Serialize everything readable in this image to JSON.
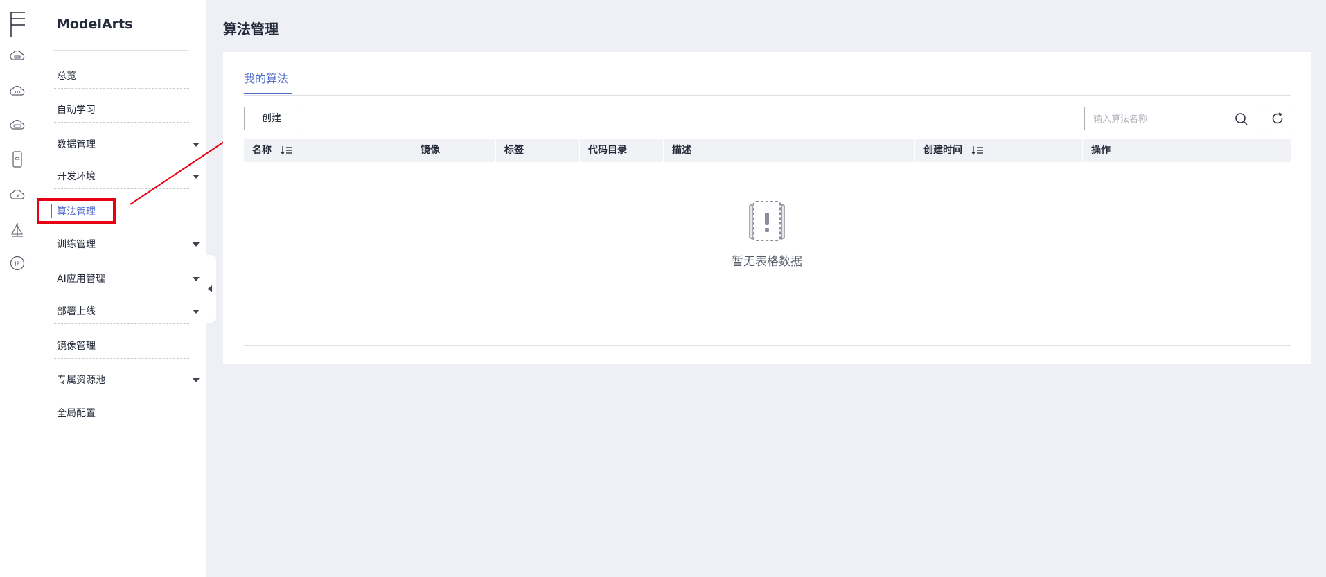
{
  "app": {
    "name": "ModelArts"
  },
  "sidebar": {
    "items": [
      {
        "label": "总览",
        "has_children": false
      },
      {
        "label": "自动学习",
        "has_children": false
      },
      {
        "label": "数据管理",
        "has_children": true
      },
      {
        "label": "开发环境",
        "has_children": true
      },
      {
        "label": "算法管理",
        "has_children": false,
        "active": true
      },
      {
        "label": "训练管理",
        "has_children": true
      },
      {
        "label": "AI应用管理",
        "has_children": true
      },
      {
        "label": "部署上线",
        "has_children": true
      },
      {
        "label": "镜像管理",
        "has_children": false
      },
      {
        "label": "专属资源池",
        "has_children": true
      },
      {
        "label": "全局配置",
        "has_children": false
      }
    ]
  },
  "page": {
    "title": "算法管理",
    "tabs": [
      {
        "label": "我的算法",
        "active": true
      }
    ],
    "toolbar": {
      "create_label": "创建",
      "search_placeholder": "输入算法名称"
    },
    "table": {
      "columns": [
        "名称",
        "镜像",
        "标签",
        "代码目录",
        "描述",
        "创建时间",
        "操作"
      ],
      "rows": [],
      "empty_text": "暂无表格数据"
    }
  },
  "theme": {
    "accent": "#526ecc",
    "annotation": "#e60012",
    "background": "#eff0f5"
  },
  "icons": [
    "menu-icon",
    "cloud-storage-icon",
    "cloud-more-icon",
    "cloud-service-icon",
    "mobile-device-icon",
    "cloud-speed-icon",
    "sailboat-icon",
    "ip-icon",
    "search-icon",
    "refresh-icon",
    "sort-icon",
    "empty-data-icon"
  ]
}
